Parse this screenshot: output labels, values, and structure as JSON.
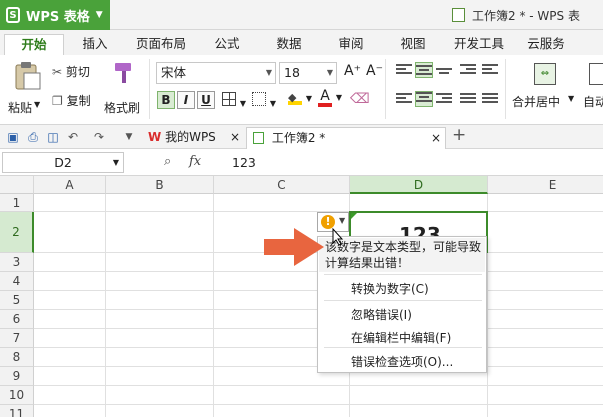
{
  "app": {
    "name": "WPS 表格",
    "logo": "S",
    "window_title": "工作簿2 * - WPS 表"
  },
  "ribbon_tabs": [
    "开始",
    "插入",
    "页面布局",
    "公式",
    "数据",
    "审阅",
    "视图",
    "开发工具",
    "云服务"
  ],
  "clipboard": {
    "paste": "粘贴",
    "cut": "剪切",
    "copy": "复制",
    "format_painter": "格式刷"
  },
  "font": {
    "name": "宋体",
    "size": "18",
    "bold": "B",
    "italic": "I",
    "underline": "U",
    "grow": "A⁺",
    "shrink": "A⁻",
    "font_color": "A"
  },
  "alignment": {
    "merge_center": "合并居中",
    "auto_wrap": "自动"
  },
  "doc_tabs": [
    {
      "label": "我的WPS",
      "close": "×"
    },
    {
      "label": "工作簿2 *",
      "close": "×"
    }
  ],
  "new_tab": "+",
  "formula_bar": {
    "cell_ref": "D2",
    "fx": "fx",
    "value": "123"
  },
  "columns": [
    "A",
    "B",
    "C",
    "D",
    "E"
  ],
  "rows": [
    "1",
    "2",
    "3",
    "4",
    "5",
    "6",
    "7",
    "8",
    "9",
    "10",
    "11"
  ],
  "cell_d2": "123",
  "error_popup": {
    "message": "该数字是文本类型，可能导致计算结果出错！",
    "items": [
      "转换为数字(C)",
      "忽略错误(I)",
      "在编辑栏中编辑(F)",
      "错误检查选项(O)..."
    ]
  },
  "colors": {
    "accent": "#4aa23a",
    "arrow": "#e8653f",
    "warn": "#f0a000"
  }
}
